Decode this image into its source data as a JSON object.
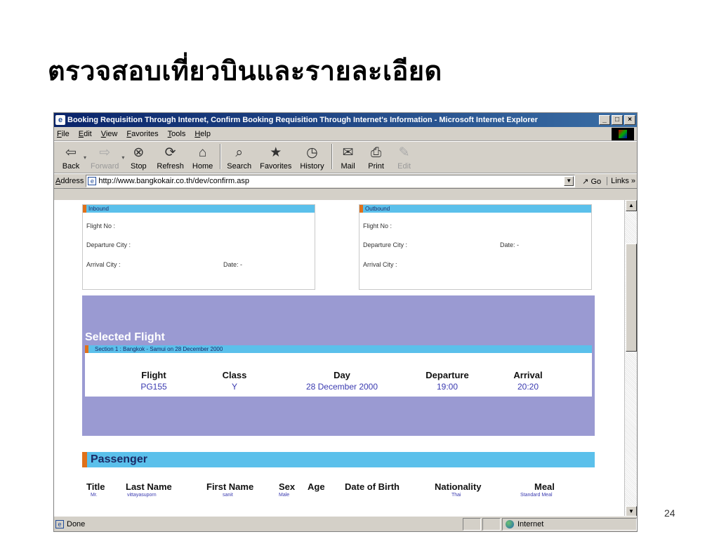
{
  "slide": {
    "title": "ตรวจสอบเที่ยวบินและรายละเอียด",
    "page_number": "24"
  },
  "window": {
    "title": "Booking Requisition Through Internet, Confirm Booking Requisition Through Internet's Information - Microsoft Internet Explorer",
    "controls": {
      "minimize": "_",
      "maximize": "□",
      "close": "×"
    }
  },
  "menu": [
    "File",
    "Edit",
    "View",
    "Favorites",
    "Tools",
    "Help"
  ],
  "toolbar": [
    {
      "label": "Back",
      "icon": "back-arrow-icon",
      "glyph": "⇦",
      "enabled": true
    },
    {
      "label": "Forward",
      "icon": "forward-arrow-icon",
      "glyph": "⇨",
      "enabled": false
    },
    {
      "label": "Stop",
      "icon": "stop-icon",
      "glyph": "⊗",
      "enabled": true
    },
    {
      "label": "Refresh",
      "icon": "refresh-icon",
      "glyph": "⟳",
      "enabled": true
    },
    {
      "label": "Home",
      "icon": "home-icon",
      "glyph": "⌂",
      "enabled": true
    },
    {
      "label": "Search",
      "icon": "search-icon",
      "glyph": "⌕",
      "enabled": true
    },
    {
      "label": "Favorites",
      "icon": "favorites-icon",
      "glyph": "★",
      "enabled": true
    },
    {
      "label": "History",
      "icon": "history-icon",
      "glyph": "◷",
      "enabled": true
    },
    {
      "label": "Mail",
      "icon": "mail-icon",
      "glyph": "✉",
      "enabled": true
    },
    {
      "label": "Print",
      "icon": "print-icon",
      "glyph": "⎙",
      "enabled": true
    },
    {
      "label": "Edit",
      "icon": "edit-icon",
      "glyph": "✎",
      "enabled": false
    }
  ],
  "address": {
    "label": "Address",
    "url": "http://www.bangkokair.co.th/dev/confirm.asp",
    "go": "Go",
    "links": "Links »"
  },
  "inbound": {
    "header": "Inbound",
    "flight_no": "Flight No :",
    "departure_city": "Departure City :",
    "arrival_city": "Arrival City :",
    "date": "Date:  -"
  },
  "outbound": {
    "header": "Outbound",
    "flight_no": "Flight No :",
    "departure_city": "Departure City :",
    "arrival_city": "Arrival City :",
    "date": "Date:  -"
  },
  "selected_flight": {
    "title": "Selected Flight",
    "section": "Section 1 : Bangkok - Samui on 28 December 2000",
    "columns": [
      "Flight",
      "Class",
      "Day",
      "Departure",
      "Arrival"
    ],
    "values": [
      "PG155",
      "Y",
      "28 December 2000",
      "19:00",
      "20:20"
    ]
  },
  "passenger": {
    "title": "Passenger",
    "columns": [
      "Title",
      "Last Name",
      "First Name",
      "Sex",
      "Age",
      "Date of Birth",
      "Nationality",
      "Meal"
    ],
    "values": [
      "Mr.",
      "vittayasuporn",
      "sanit",
      "Male",
      "",
      "",
      "Thai",
      "Standard Meal"
    ]
  },
  "status": {
    "text": "Done",
    "zone": "Internet"
  },
  "colors": {
    "title_bar": "#0a246a",
    "section_header": "#5bc0eb",
    "header_accent": "#e0711a",
    "selected_flight_bg": "#9a9ad2",
    "value_text": "#3a3ab0"
  }
}
